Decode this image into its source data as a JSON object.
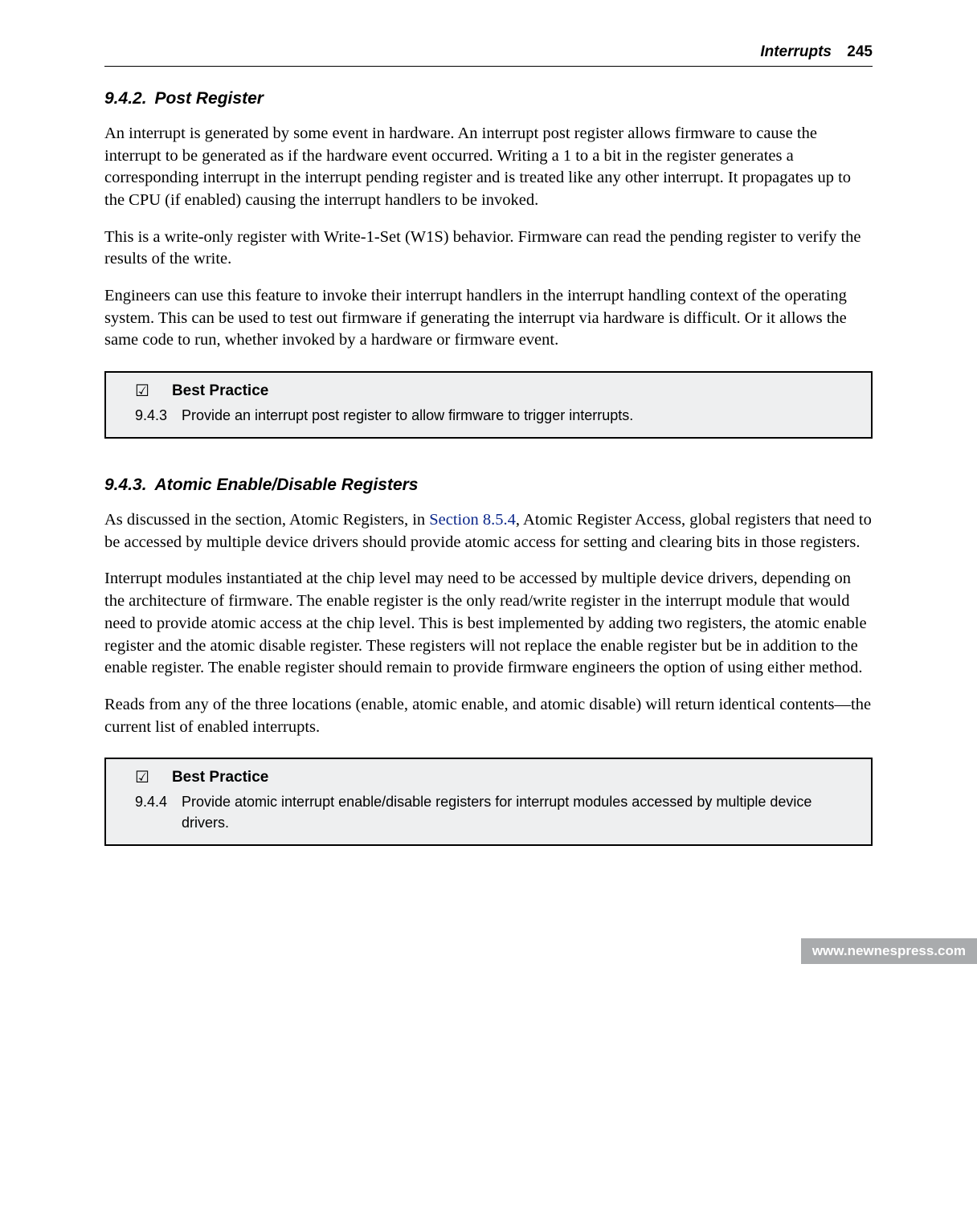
{
  "header": {
    "chapter_title": "Interrupts",
    "page_number": "245"
  },
  "sections": [
    {
      "number": "9.4.2.",
      "title": "Post Register",
      "paragraphs": [
        "An interrupt is generated by some event in hardware. An interrupt post register allows firmware to cause the interrupt to be generated as if the hardware event occurred. Writing a 1 to a bit in the register generates a corresponding interrupt in the interrupt pending register and is treated like any other interrupt. It propagates up to the CPU (if enabled) causing the interrupt handlers to be invoked.",
        "This is a write-only register with Write-1-Set (W1S) behavior. Firmware can read the pending register to verify the results of the write.",
        "Engineers can use this feature to invoke their interrupt handlers in the interrupt handling context of the operating system. This can be used to test out firmware if generating the interrupt via hardware is difficult. Or it allows the same code to run, whether invoked by a hardware or firmware event."
      ],
      "best_practice": {
        "label": "Best Practice",
        "number": "9.4.3",
        "text": "Provide an interrupt post register to allow firmware to trigger interrupts."
      }
    },
    {
      "number": "9.4.3.",
      "title": "Atomic Enable/Disable Registers",
      "paragraphs_before_link": "As discussed in the section, Atomic Registers, in ",
      "link_text": "Section 8.5.4",
      "paragraphs_after_link": ", Atomic Register Access, global registers that need to be accessed by multiple device drivers should provide atomic access for setting and clearing bits in those registers.",
      "paragraphs_rest": [
        "Interrupt modules instantiated at the chip level may need to be accessed by multiple device drivers, depending on the architecture of firmware. The enable register is the only read/write register in the interrupt module that would need to provide atomic access at the chip level. This is best implemented by adding two registers, the atomic enable register and the atomic disable register. These registers will not replace the enable register but be in addition to the enable register. The enable register should remain to provide firmware engineers the option of using either method.",
        "Reads from any of the three locations (enable, atomic enable, and atomic disable) will return identical contents—the current list of enabled interrupts."
      ],
      "best_practice": {
        "label": "Best Practice",
        "number": "9.4.4",
        "text": "Provide atomic interrupt enable/disable registers for interrupt modules accessed by multiple device drivers."
      }
    }
  ],
  "footer": {
    "url": "www.newnespress.com"
  },
  "check_glyph": "☑"
}
